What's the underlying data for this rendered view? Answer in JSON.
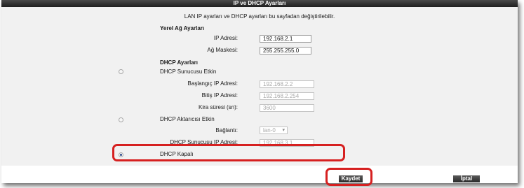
{
  "header": {
    "title": "IP ve DHCP Ayarları"
  },
  "description": "LAN IP ayarları ve DHCP ayarları bu sayfadan değiştirilebilir.",
  "lan": {
    "section_title": "Yerel Ağ Ayarları",
    "ip_label": "IP Adresi:",
    "ip_value": "192.168.2.1",
    "mask_label": "Ağ Maskesi:",
    "mask_value": "255.255.255.0"
  },
  "dhcp": {
    "section_title": "DHCP Ayarları",
    "server_option": "DHCP Sunucusu Etkin",
    "start_label": "Başlangıç IP Adresi:",
    "start_value": "192.168.2.2",
    "end_label": "Bitiş IP Adresi:",
    "end_value": "192.168.2.254",
    "lease_label": "Kira süresi (sn):",
    "lease_value": "3600",
    "relay_option": "DHCP Aktarıcısı Etkin",
    "connection_label": "Bağlantı:",
    "connection_value": "lan-0",
    "relay_server_label": "DHCP Sunucusu IP Adresi:",
    "relay_server_value": "192.168.3.1",
    "off_option": "DHCP Kapalı",
    "selected": "off"
  },
  "buttons": {
    "save": "Kaydet",
    "cancel": "İptal"
  },
  "colors": {
    "highlight": "#d62020",
    "header_bg": "#2b2b2b",
    "panel_bg": "#f1f1f1"
  }
}
